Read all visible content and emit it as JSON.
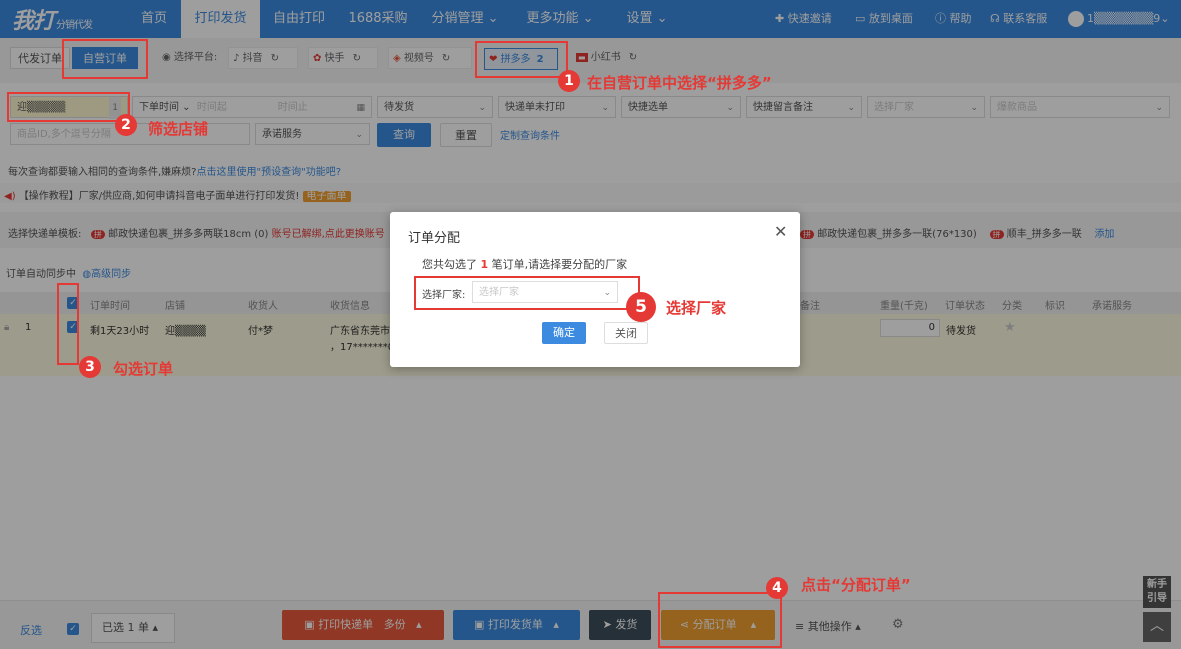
{
  "nav": {
    "logo": "我打",
    "logo_sub": "分销代发",
    "items": [
      "首页",
      "打印发货",
      "自由打印",
      "1688采购",
      "分销管理 ⌄",
      "更多功能 ⌄",
      "设置 ⌄"
    ],
    "right": [
      "快速邀请",
      "放到桌面",
      "帮助",
      "联系客服"
    ],
    "user": "1▒▒▒▒▒▒▒9⌄"
  },
  "tabs": {
    "daifa": "代发订单",
    "ziying": "自营订单",
    "platform_label": "选择平台:"
  },
  "platforms": [
    "抖音",
    "快手",
    "视频号",
    "拼多多",
    "小红书"
  ],
  "pdd_count": "2",
  "filters": {
    "shop": "迎▒▒▒▒▒",
    "shop_count": "1",
    "order_time": "下单时间",
    "time_start": "时间起",
    "time_end": "时间止",
    "status": "待发货",
    "express_print": "快递单未打印",
    "quick_select": "快捷选单",
    "quick_remark": "快捷留言备注",
    "factory": "选择厂家",
    "hot_goods": "爆款商品",
    "goods_id": "商品ID,多个逗号分隔",
    "promise": "承诺服务",
    "query": "查询",
    "reset": "重置",
    "custom": "定制查询条件"
  },
  "tip": {
    "text": "每次查询都要输入相同的查询条件,嫌麻烦?",
    "link": "点击这里使用\"预设查询\"功能吧?"
  },
  "notice": {
    "text": "【操作教程】厂家/供应商,如何申请抖音电子面单进行打印发货!",
    "tag": "电子面单"
  },
  "template": {
    "label": "选择快递单模板:",
    "item1": "邮政快递包裹_拼多多两联18cm (0)",
    "warn": "账号已解绑,点此更换账号",
    "item2": "邮政快递包裹_拼多多一联(76*130)",
    "item3": "顺丰_拼多多一联",
    "add": "添加"
  },
  "sync": {
    "text": "订单自动同步中",
    "adv": "高级同步"
  },
  "table": {
    "headers": [
      "订单时间",
      "店铺",
      "收货人",
      "收货信息",
      "备注",
      "重量(千克)",
      "订单状态",
      "分类",
      "标识",
      "承诺服务"
    ],
    "row": {
      "idx": "1",
      "time": "剩1天23小时",
      "shop": "迎▒▒▒▒",
      "receiver": "付*梦",
      "address": "广东省东莞市",
      "phone": "，17*******08",
      "weight": "0",
      "status": "待发货"
    }
  },
  "bottom": {
    "invert": "反选",
    "selected": "已选 1 单",
    "print_express": "打印快递单",
    "multi": "多份",
    "print_ship": "打印发货单",
    "ship": "发货",
    "assign": "分配订单",
    "other": "其他操作",
    "guide": "新手引导"
  },
  "modal": {
    "title": "订单分配",
    "msg_pre": "您共勾选了",
    "msg_num": "1",
    "msg_post": "笔订单,请选择要分配的厂家",
    "label": "选择厂家:",
    "placeholder": "选择厂家",
    "ok": "确定",
    "close": "关闭"
  },
  "annotations": {
    "a1": "在自营订单中选择“拼多多”",
    "a2": "筛选店铺",
    "a3": "勾选订单",
    "a4": "点击“分配订单”",
    "a5": "选择厂家"
  },
  "colors": {
    "primary": "#3d8be0",
    "highlight": "#e53935",
    "orange": "#f0a030",
    "red_btn": "#e85a3c"
  }
}
